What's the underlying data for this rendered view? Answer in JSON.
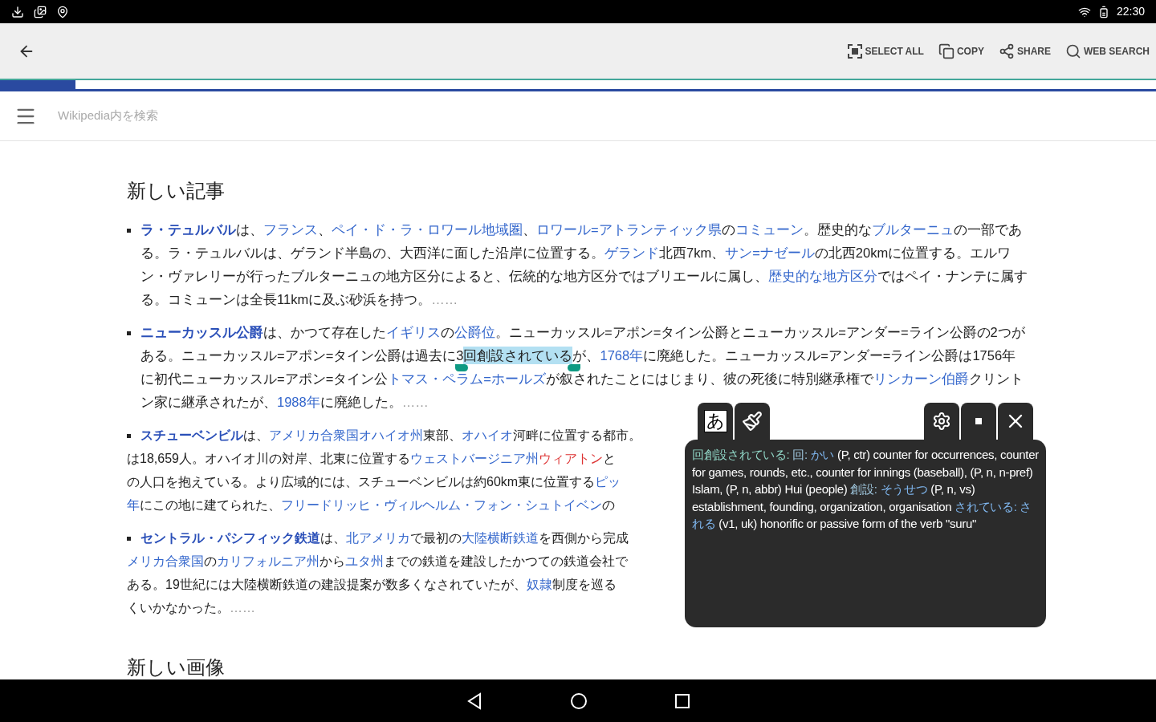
{
  "status_bar": {
    "time": "22:30"
  },
  "action_bar": {
    "actions": [
      {
        "kind": "select_all",
        "label": "SELECT ALL"
      },
      {
        "kind": "copy",
        "label": "COPY"
      },
      {
        "kind": "share",
        "label": "SHARE"
      },
      {
        "kind": "web_search",
        "label": "WEB SEARCH"
      }
    ]
  },
  "search": {
    "placeholder": "Wikipedia内を検索"
  },
  "sections": [
    {
      "title": "新しい記事"
    },
    {
      "title": "新しい画像"
    }
  ],
  "articles": [
    {
      "kind": "flow",
      "segments": [
        {
          "kind": "bold_link",
          "text": "ラ・テュルバル"
        },
        {
          "kind": "text",
          "text": "は、"
        },
        {
          "kind": "link",
          "text": "フランス"
        },
        {
          "kind": "text",
          "text": "、"
        },
        {
          "kind": "link",
          "text": "ペイ・ド・ラ・ロワール地域圏"
        },
        {
          "kind": "text",
          "text": "、"
        },
        {
          "kind": "link",
          "text": "ロワール=アトランティック県"
        },
        {
          "kind": "text",
          "text": "の"
        },
        {
          "kind": "link",
          "text": "コミューン"
        },
        {
          "kind": "text",
          "text": "。歴史的な"
        },
        {
          "kind": "link",
          "text": "ブルターニュ"
        },
        {
          "kind": "text",
          "text": "の一部である。ラ・テュルバルは、ゲランド半島の、大西洋に面した沿岸に位置する。"
        },
        {
          "kind": "link",
          "text": "ゲランド"
        },
        {
          "kind": "text",
          "text": "北西7km、"
        },
        {
          "kind": "link",
          "text": "サン=ナゼール"
        },
        {
          "kind": "text",
          "text": "の北西20kmに位置する。エルワン・ヴァレリーが行ったブルターニュの地方区分によると、伝統的な地方区分ではブリエールに属し、"
        },
        {
          "kind": "link",
          "text": "歴史的な地方区分"
        },
        {
          "kind": "text",
          "text": "ではペイ・ナンテに属する。コミューンは全長11kmに及ぶ砂浜を持つ。"
        },
        {
          "kind": "more",
          "text": "……"
        }
      ]
    },
    {
      "kind": "flow",
      "segments": [
        {
          "kind": "bold_link",
          "text": "ニューカッスル公爵"
        },
        {
          "kind": "text",
          "text": "は、かつて存在した"
        },
        {
          "kind": "link",
          "text": "イギリス"
        },
        {
          "kind": "text",
          "text": "の"
        },
        {
          "kind": "link",
          "text": "公爵位"
        },
        {
          "kind": "text",
          "text": "。ニューカッスル=アポン=タイン公爵とニューカッスル=アンダー=ライン公爵の2つがある。ニューカッスル=アポン=タイン公爵は過去に3"
        },
        {
          "kind": "selected",
          "text": "回創設されている"
        },
        {
          "kind": "text",
          "text": "が、"
        },
        {
          "kind": "link",
          "text": "1768年"
        },
        {
          "kind": "text",
          "text": "に廃絶した。ニューカッスル=アンダー=ライン公爵は1756年に初代ニューカッスル=アポン=タイン公"
        },
        {
          "kind": "link",
          "text": "トマス・ペラム=ホールズ"
        },
        {
          "kind": "text",
          "text": "が叙されたことにはじまり、彼の死後に特別継承権で"
        },
        {
          "kind": "link",
          "text": "リンカーン伯爵"
        },
        {
          "kind": "text",
          "text": "クリントン家に継承されたが、"
        },
        {
          "kind": "link",
          "text": "1988年"
        },
        {
          "kind": "text",
          "text": "に廃絶した。"
        },
        {
          "kind": "more",
          "text": "……"
        }
      ]
    },
    {
      "kind": "lines",
      "lines": [
        [
          {
            "kind": "bold_link",
            "text": "スチューベンビル"
          },
          {
            "kind": "text",
            "text": "は、"
          },
          {
            "kind": "link",
            "text": "アメリカ合衆国オハイオ州"
          },
          {
            "kind": "text",
            "text": "東部、"
          },
          {
            "kind": "link",
            "text": "オハイオ"
          },
          {
            "kind": "text",
            "text": "河畔に位置する都市。"
          }
        ],
        [
          {
            "kind": "text",
            "text": "は18,659人。オハイオ川の対岸、北東に位置する"
          },
          {
            "kind": "link",
            "text": "ウェストバージニア州"
          },
          {
            "kind": "red_link",
            "text": "ウィアトン"
          },
          {
            "kind": "text",
            "text": "と"
          }
        ],
        [
          {
            "kind": "text",
            "text": "の人口を抱えている。より広域的には、スチューベンビルは約60km東に位置する"
          },
          {
            "kind": "link",
            "text": "ピッ"
          }
        ],
        [
          {
            "kind": "link",
            "text": "年"
          },
          {
            "kind": "text",
            "text": "にこの地に建てられた、"
          },
          {
            "kind": "link",
            "text": "フリードリッヒ・ヴィルヘルム・フォン・シュトイベン"
          },
          {
            "kind": "text",
            "text": "の"
          }
        ]
      ]
    },
    {
      "kind": "lines",
      "lines": [
        [
          {
            "kind": "bold_link",
            "text": "セントラル・パシフィック鉄道"
          },
          {
            "kind": "text",
            "text": "は、"
          },
          {
            "kind": "link",
            "text": "北アメリカ"
          },
          {
            "kind": "text",
            "text": "で最初の"
          },
          {
            "kind": "link",
            "text": "大陸横断鉄道"
          },
          {
            "kind": "text",
            "text": "を西側から完成"
          }
        ],
        [
          {
            "kind": "link",
            "text": "メリカ合衆国"
          },
          {
            "kind": "text",
            "text": "の"
          },
          {
            "kind": "link",
            "text": "カリフォルニア州"
          },
          {
            "kind": "text",
            "text": "から"
          },
          {
            "kind": "link",
            "text": "ユタ州"
          },
          {
            "kind": "text",
            "text": "までの鉄道を建設したかつての鉄道会社で"
          }
        ],
        [
          {
            "kind": "text",
            "text": "ある。19世紀には大陸横断鉄道の建設提案が数多くなされていたが、"
          },
          {
            "kind": "link",
            "text": "奴隷"
          },
          {
            "kind": "text",
            "text": "制度を巡る"
          }
        ],
        [
          {
            "kind": "text",
            "text": "くいかなかった。"
          },
          {
            "kind": "more",
            "text": "……"
          }
        ]
      ]
    }
  ],
  "popup": {
    "mode_glyph": "あ",
    "segments": [
      {
        "kind": "term",
        "text": "回創設されている:"
      },
      {
        "kind": "word",
        "text": "回:"
      },
      {
        "kind": "reading",
        "text": "かい"
      },
      {
        "kind": "text",
        "text": "(P, ctr) counter for occurrences, counter for games, rounds, etc., counter for innings (baseball), (P, n, n-pref) Islam, (P, n, abbr) Hui (people)"
      },
      {
        "kind": "word",
        "text": "創設:"
      },
      {
        "kind": "reading",
        "text": "そうせつ"
      },
      {
        "kind": "text",
        "text": "(P, n, vs) establishment, founding, organization, organisation"
      },
      {
        "kind": "reading",
        "text": "されている: される"
      },
      {
        "kind": "text",
        "text": "(v1, uk) honorific or passive form of the verb \"suru\""
      }
    ]
  }
}
